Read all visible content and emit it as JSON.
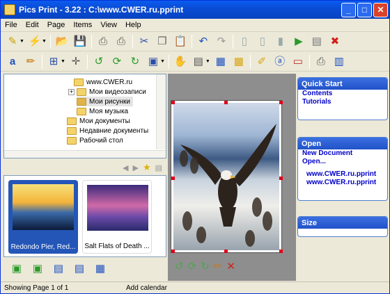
{
  "window": {
    "title": "Pics Print - 3.22 :  C:\\www.CWER.ru.pprint"
  },
  "menu": [
    "File",
    "Edit",
    "Page",
    "Items",
    "View",
    "Help"
  ],
  "tree": {
    "items": [
      {
        "label": "www.CWER.ru",
        "icon": "folder-icon"
      },
      {
        "label": "Мои видеозаписи",
        "icon": "folder-video-icon"
      },
      {
        "label": "Мои рисунки",
        "icon": "folder-pictures-icon",
        "selected": true
      },
      {
        "label": "Моя музыка",
        "icon": "folder-music-icon"
      },
      {
        "label": "Мои документы",
        "icon": "folder-documents-icon"
      },
      {
        "label": "Недавние документы",
        "icon": "folder-recent-icon"
      },
      {
        "label": "Рабочий стол",
        "icon": "folder-desktop-icon"
      }
    ]
  },
  "thumbnails": [
    {
      "caption": "Redondo Pier, Red...",
      "selected": true
    },
    {
      "caption": "Salt Flats of Death ...",
      "selected": false
    }
  ],
  "panels": {
    "quick_start": {
      "title": "Quick Start",
      "links": [
        "Contents",
        "Tutorials"
      ]
    },
    "open": {
      "title": "Open",
      "links": [
        "New Document",
        "Open...",
        "www.CWER.ru.pprint",
        "www.CWER.ru.pprint"
      ]
    },
    "size": {
      "title": "Size"
    }
  },
  "status": {
    "left": "Showing Page 1 of 1",
    "hint": "Add calendar"
  },
  "colors": {
    "titlebar": "#0a50dd",
    "panel_header": "#2f60d8",
    "link": "#0000c8",
    "selection": "#2456b8"
  }
}
